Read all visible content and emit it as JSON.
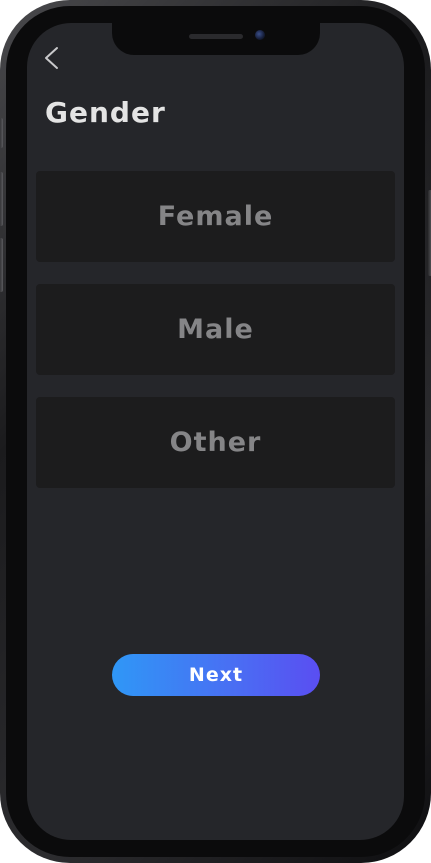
{
  "header": {
    "back_icon": "chevron-left-icon",
    "title": "Gender"
  },
  "options": [
    {
      "label": "Female"
    },
    {
      "label": "Male"
    },
    {
      "label": "Other"
    }
  ],
  "footer": {
    "next_label": "Next"
  },
  "colors": {
    "screen_background": "#25262a",
    "option_background": "#1c1c1d",
    "option_text": "#858587",
    "title_text": "#e4e4e4",
    "button_gradient_start": "#2f97f6",
    "button_gradient_end": "#5a4ef2"
  }
}
